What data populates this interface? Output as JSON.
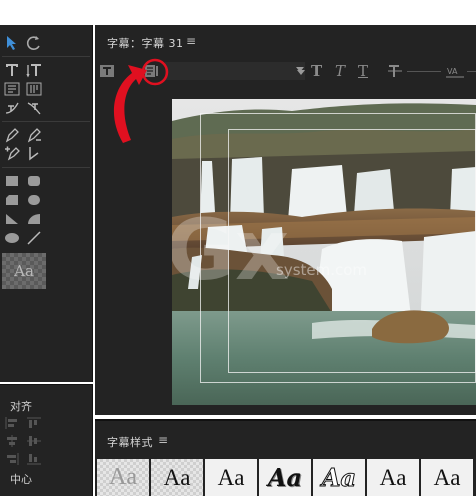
{
  "title_panel": {
    "title": "字幕：字幕 31",
    "menu_icon": "≡"
  },
  "styles_panel": {
    "title": "字幕样式",
    "menu_icon": "≡",
    "samples": [
      "Aa",
      "Aa",
      "Aa",
      "Aa",
      "Aa",
      "Aa",
      "Aa"
    ]
  },
  "tools_panel": {
    "style_swatch": "Aa"
  },
  "align_panel": {
    "title": "对齐",
    "center_title": "中心"
  },
  "watermark": {
    "text": "Gx",
    "site": "system.com"
  },
  "colors": {
    "panel_bg": "#232323",
    "annotation_red": "#e01020"
  }
}
